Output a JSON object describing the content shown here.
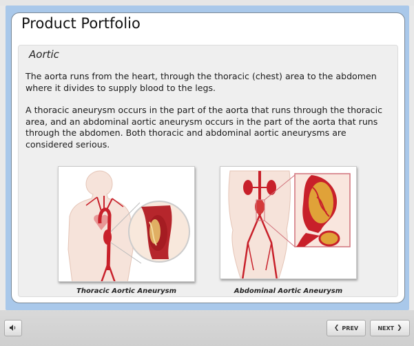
{
  "header": {
    "title": "Product Portfolio"
  },
  "section": {
    "title": "Aortic"
  },
  "body": {
    "paragraph1": "The aorta runs from the heart, through the thoracic (chest) area to the abdomen where it divides to supply blood to the legs.",
    "paragraph2": "A thoracic aneurysm occurs in the part of the aorta that runs through the thoracic area, and an abdominal aortic aneurysm occurs in the part of the aorta that runs through the abdomen. Both thoracic and abdominal aortic aneurysms are considered serious."
  },
  "images": [
    {
      "caption": "Thoracic Aortic Aneurysm"
    },
    {
      "caption": "Abdominal Aortic Aneurysm"
    }
  ],
  "nav": {
    "prev_label": "PREV",
    "next_label": "NEXT",
    "audio_icon": "speaker-icon",
    "prev_icon": "chevron-left-icon",
    "next_icon": "chevron-right-icon"
  },
  "colors": {
    "frame": "#a9c8ea",
    "artery": "#c8202a",
    "skin": "#f3d6c8"
  }
}
